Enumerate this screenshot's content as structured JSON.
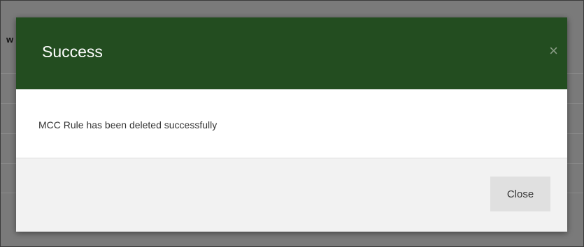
{
  "background": {
    "partial_text": "w"
  },
  "modal": {
    "title": "Success",
    "close_icon": "×",
    "message": "MCC Rule has been deleted successfully",
    "close_button_label": "Close"
  },
  "colors": {
    "header": "#234d20",
    "overlay": "#7a7a7a",
    "footer": "#f2f2f2",
    "button": "#e0e0e0"
  }
}
